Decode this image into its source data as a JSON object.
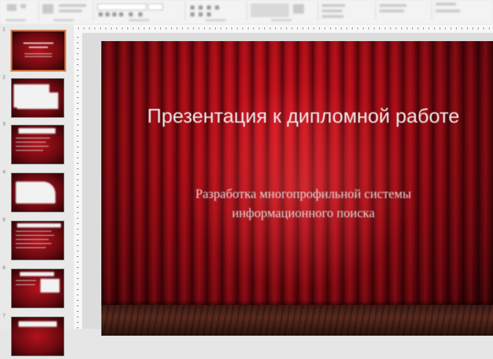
{
  "slide": {
    "title": "Презентация к дипломной работе",
    "subtitle": "Разработка многопрофильной системы информационного поиска"
  },
  "thumbnails": [
    {
      "number": "1",
      "selected": true
    },
    {
      "number": "2",
      "selected": false
    },
    {
      "number": "3",
      "selected": false
    },
    {
      "number": "4",
      "selected": false
    },
    {
      "number": "5",
      "selected": false
    },
    {
      "number": "6",
      "selected": false
    },
    {
      "number": "7",
      "selected": false
    }
  ],
  "colors": {
    "curtain_red": "#b3121c",
    "selection": "#c86d3e",
    "ribbon_bg": "#f3f3f3"
  }
}
